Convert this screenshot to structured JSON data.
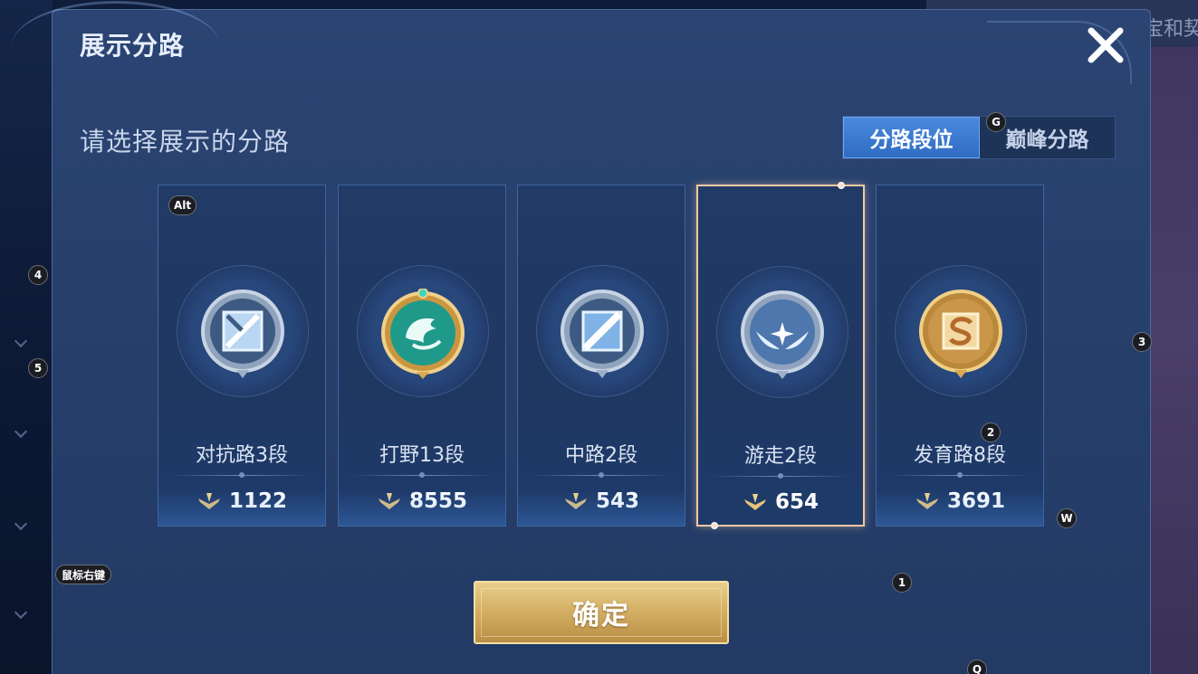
{
  "background": {
    "top_right_text": "宝和契"
  },
  "dialog": {
    "title": "展示分路",
    "subtitle": "请选择展示的分路",
    "close_icon": "close-x-icon"
  },
  "tabs": [
    {
      "label": "分路段位",
      "active": true
    },
    {
      "label": "巅峰分路",
      "active": false
    }
  ],
  "cards": [
    {
      "label": "对抗路3段",
      "score": "1122",
      "icon": "clash-lane-silver-icon",
      "selected": false
    },
    {
      "label": "打野13段",
      "score": "8555",
      "icon": "jungle-dragon-gold-icon",
      "selected": false
    },
    {
      "label": "中路2段",
      "score": "543",
      "icon": "mid-lane-silver-icon",
      "selected": false
    },
    {
      "label": "游走2段",
      "score": "654",
      "icon": "roam-wings-silver-icon",
      "selected": true
    },
    {
      "label": "发育路8段",
      "score": "3691",
      "icon": "farm-lane-gold-icon",
      "selected": false
    }
  ],
  "confirm_button": {
    "label": "确定"
  },
  "key_hints": {
    "alt": "Alt",
    "g": "G",
    "one": "1",
    "two": "2",
    "three": "3",
    "four": "4",
    "five": "5",
    "w": "W",
    "q": "Q",
    "right_click": "鼠标右键"
  },
  "colors": {
    "panel": "#27406c",
    "active_tab": "#3a7bd5",
    "selected_border": "#f2c8a4",
    "confirm_gold": "#d2ad62"
  }
}
